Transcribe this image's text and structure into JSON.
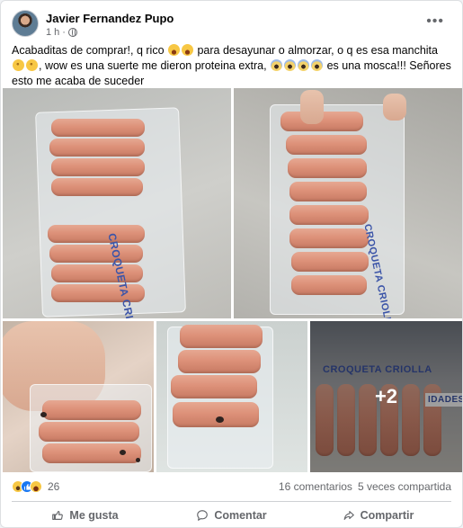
{
  "post": {
    "author": "Javier Fernandez Pupo",
    "time": "1 h",
    "separator": "·",
    "more": "•••",
    "text_part1": "Acabaditas de comprar!, q rico ",
    "text_part2": " para desayunar o almorzar, o q es esa manchita ",
    "text_part3": ", wow es una suerte me dieron proteina extra, ",
    "text_part4": " es una mosca!!! Señores esto me acaba de suceder"
  },
  "photos": {
    "label_1": "CROQUETA CRIO",
    "label_2": "CROQUETA CRIOLLA",
    "label_3": "CROQUETA CRIOLL",
    "badge": "IDADES",
    "more_count": "+2"
  },
  "reactions": {
    "count": "26",
    "comments": "16 comentarios",
    "shares": "5 veces compartida"
  },
  "actions": {
    "like": "Me gusta",
    "comment": "Comentar",
    "share": "Compartir"
  },
  "colors": {
    "accent": "#1877f2",
    "secondary_text": "#65676b",
    "label_blue": "#3c55a8"
  }
}
